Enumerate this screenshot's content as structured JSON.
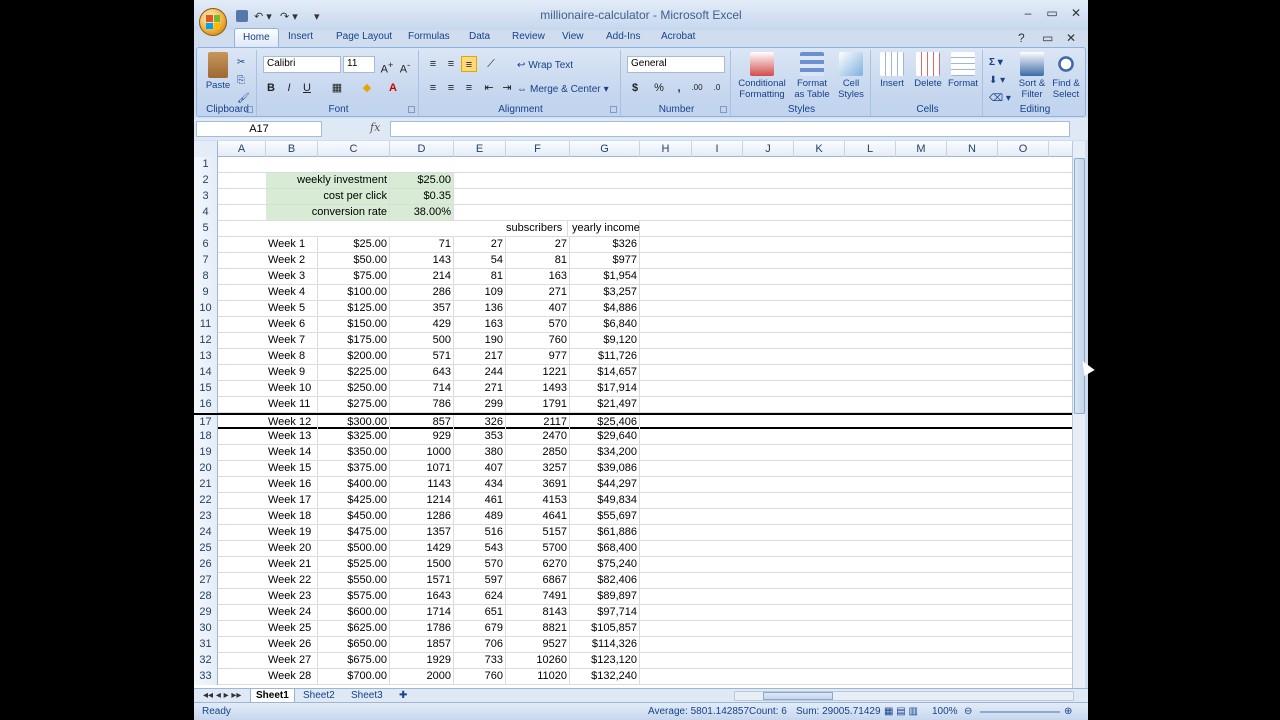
{
  "window": {
    "title": "millionaire-calculator - Microsoft Excel"
  },
  "tabs": [
    "Home",
    "Insert",
    "Page Layout",
    "Formulas",
    "Data",
    "Review",
    "View",
    "Add-Ins",
    "Acrobat"
  ],
  "ribbon": {
    "clipboard": {
      "label": "Clipboard",
      "paste": "Paste"
    },
    "font": {
      "label": "Font",
      "name": "Calibri",
      "size": "11",
      "bold": "B",
      "italic": "I",
      "underline": "U"
    },
    "alignment": {
      "label": "Alignment",
      "wrap_text": "Wrap Text",
      "merge_center": "Merge & Center"
    },
    "number": {
      "label": "Number",
      "format": "General",
      "currency": "$",
      "percent": "%",
      "comma": ","
    },
    "styles": {
      "label": "Styles",
      "conditional": [
        "Conditional",
        "Formatting"
      ],
      "format_table": [
        "Format",
        "as Table"
      ],
      "cell_styles": [
        "Cell",
        "Styles"
      ]
    },
    "cells": {
      "label": "Cells",
      "insert": "Insert",
      "delete": "Delete",
      "format": "Format"
    },
    "editing": {
      "label": "Editing",
      "sort_filter": [
        "Sort &",
        "Filter"
      ],
      "find_select": [
        "Find &",
        "Select"
      ]
    }
  },
  "formula_bar": {
    "name_box": "A17",
    "fx": "fx",
    "value": ""
  },
  "columns": [
    "A",
    "B",
    "C",
    "D",
    "E",
    "F",
    "G",
    "H",
    "I",
    "J",
    "K",
    "L",
    "M",
    "N",
    "O"
  ],
  "params": [
    {
      "row": 2,
      "label": "weekly investment",
      "value": "$25.00"
    },
    {
      "row": 3,
      "label": "cost per click",
      "value": "$0.35"
    },
    {
      "row": 4,
      "label": "conversion rate",
      "value": "38.00%"
    }
  ],
  "headers_row5": {
    "F": "subscribers",
    "G": "yearly income"
  },
  "weeks": [
    {
      "row": 6,
      "B": "Week 1",
      "C": "$25.00",
      "D": "71",
      "E": "27",
      "F": "27",
      "G": "$326"
    },
    {
      "row": 7,
      "B": "Week 2",
      "C": "$50.00",
      "D": "143",
      "E": "54",
      "F": "81",
      "G": "$977"
    },
    {
      "row": 8,
      "B": "Week 3",
      "C": "$75.00",
      "D": "214",
      "E": "81",
      "F": "163",
      "G": "$1,954"
    },
    {
      "row": 9,
      "B": "Week 4",
      "C": "$100.00",
      "D": "286",
      "E": "109",
      "F": "271",
      "G": "$3,257"
    },
    {
      "row": 10,
      "B": "Week 5",
      "C": "$125.00",
      "D": "357",
      "E": "136",
      "F": "407",
      "G": "$4,886"
    },
    {
      "row": 11,
      "B": "Week 6",
      "C": "$150.00",
      "D": "429",
      "E": "163",
      "F": "570",
      "G": "$6,840"
    },
    {
      "row": 12,
      "B": "Week 7",
      "C": "$175.00",
      "D": "500",
      "E": "190",
      "F": "760",
      "G": "$9,120"
    },
    {
      "row": 13,
      "B": "Week 8",
      "C": "$200.00",
      "D": "571",
      "E": "217",
      "F": "977",
      "G": "$11,726"
    },
    {
      "row": 14,
      "B": "Week 9",
      "C": "$225.00",
      "D": "643",
      "E": "244",
      "F": "1221",
      "G": "$14,657"
    },
    {
      "row": 15,
      "B": "Week 10",
      "C": "$250.00",
      "D": "714",
      "E": "271",
      "F": "1493",
      "G": "$17,914"
    },
    {
      "row": 16,
      "B": "Week 11",
      "C": "$275.00",
      "D": "786",
      "E": "299",
      "F": "1791",
      "G": "$21,497"
    },
    {
      "row": 17,
      "B": "Week 12",
      "C": "$300.00",
      "D": "857",
      "E": "326",
      "F": "2117",
      "G": "$25,406"
    },
    {
      "row": 18,
      "B": "Week 13",
      "C": "$325.00",
      "D": "929",
      "E": "353",
      "F": "2470",
      "G": "$29,640"
    },
    {
      "row": 19,
      "B": "Week 14",
      "C": "$350.00",
      "D": "1000",
      "E": "380",
      "F": "2850",
      "G": "$34,200"
    },
    {
      "row": 20,
      "B": "Week 15",
      "C": "$375.00",
      "D": "1071",
      "E": "407",
      "F": "3257",
      "G": "$39,086"
    },
    {
      "row": 21,
      "B": "Week 16",
      "C": "$400.00",
      "D": "1143",
      "E": "434",
      "F": "3691",
      "G": "$44,297"
    },
    {
      "row": 22,
      "B": "Week 17",
      "C": "$425.00",
      "D": "1214",
      "E": "461",
      "F": "4153",
      "G": "$49,834"
    },
    {
      "row": 23,
      "B": "Week 18",
      "C": "$450.00",
      "D": "1286",
      "E": "489",
      "F": "4641",
      "G": "$55,697"
    },
    {
      "row": 24,
      "B": "Week 19",
      "C": "$475.00",
      "D": "1357",
      "E": "516",
      "F": "5157",
      "G": "$61,886"
    },
    {
      "row": 25,
      "B": "Week 20",
      "C": "$500.00",
      "D": "1429",
      "E": "543",
      "F": "5700",
      "G": "$68,400"
    },
    {
      "row": 26,
      "B": "Week 21",
      "C": "$525.00",
      "D": "1500",
      "E": "570",
      "F": "6270",
      "G": "$75,240"
    },
    {
      "row": 27,
      "B": "Week 22",
      "C": "$550.00",
      "D": "1571",
      "E": "597",
      "F": "6867",
      "G": "$82,406"
    },
    {
      "row": 28,
      "B": "Week 23",
      "C": "$575.00",
      "D": "1643",
      "E": "624",
      "F": "7491",
      "G": "$89,897"
    },
    {
      "row": 29,
      "B": "Week 24",
      "C": "$600.00",
      "D": "1714",
      "E": "651",
      "F": "8143",
      "G": "$97,714"
    },
    {
      "row": 30,
      "B": "Week 25",
      "C": "$625.00",
      "D": "1786",
      "E": "679",
      "F": "8821",
      "G": "$105,857"
    },
    {
      "row": 31,
      "B": "Week 26",
      "C": "$650.00",
      "D": "1857",
      "E": "706",
      "F": "9527",
      "G": "$114,326"
    },
    {
      "row": 32,
      "B": "Week 27",
      "C": "$675.00",
      "D": "1929",
      "E": "733",
      "F": "10260",
      "G": "$123,120"
    },
    {
      "row": 33,
      "B": "Week 28",
      "C": "$700.00",
      "D": "2000",
      "E": "760",
      "F": "11020",
      "G": "$132,240"
    }
  ],
  "sheets": [
    "Sheet1",
    "Sheet2",
    "Sheet3"
  ],
  "status": {
    "ready": "Ready",
    "average": "Average: 5801.142857",
    "count": "Count: 6",
    "sum": "Sum: 29005.71429",
    "zoom": "100%"
  }
}
